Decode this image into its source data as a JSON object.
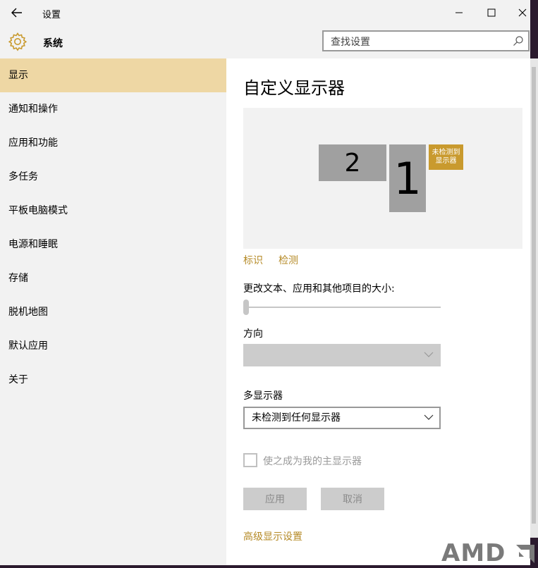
{
  "window": {
    "title": "设置"
  },
  "header": {
    "title": "系统",
    "search_placeholder": "查找设置"
  },
  "sidebar": {
    "items": [
      {
        "label": "显示",
        "active": true
      },
      {
        "label": "通知和操作",
        "active": false
      },
      {
        "label": "应用和功能",
        "active": false
      },
      {
        "label": "多任务",
        "active": false
      },
      {
        "label": "平板电脑模式",
        "active": false
      },
      {
        "label": "电源和睡眠",
        "active": false
      },
      {
        "label": "存储",
        "active": false
      },
      {
        "label": "脱机地图",
        "active": false
      },
      {
        "label": "默认应用",
        "active": false
      },
      {
        "label": "关于",
        "active": false
      }
    ]
  },
  "main": {
    "title": "自定义显示器",
    "monitors": {
      "monitor_2": "2",
      "monitor_1": "1",
      "badge_line1": "未检测到",
      "badge_line2": "显示器"
    },
    "identify_link": "标识",
    "detect_link": "检测",
    "scale_label": "更改文本、应用和其他项目的大小:",
    "scale_value_fraction": 0.0,
    "orientation_label": "方向",
    "orientation_value": "",
    "multi_display_label": "多显示器",
    "multi_display_value": "未检测到任何显示器",
    "main_display_checkbox": "使之成为我的主显示器",
    "main_display_checked": false,
    "apply_button": "应用",
    "cancel_button": "取消",
    "advanced_link": "高级显示设置"
  },
  "overlay": {
    "logo_text": "AMD"
  },
  "colors": {
    "accent": "#b58a26",
    "active_nav": "#eed7a4",
    "badge": "#c99a2e",
    "monitor": "#a0a0a0"
  },
  "icons": {
    "back": "back-arrow-icon",
    "settings": "gear-icon",
    "search": "search-icon",
    "minimize": "minimize-icon",
    "maximize": "maximize-icon",
    "close": "close-icon",
    "dropdown": "chevron-down-icon"
  }
}
